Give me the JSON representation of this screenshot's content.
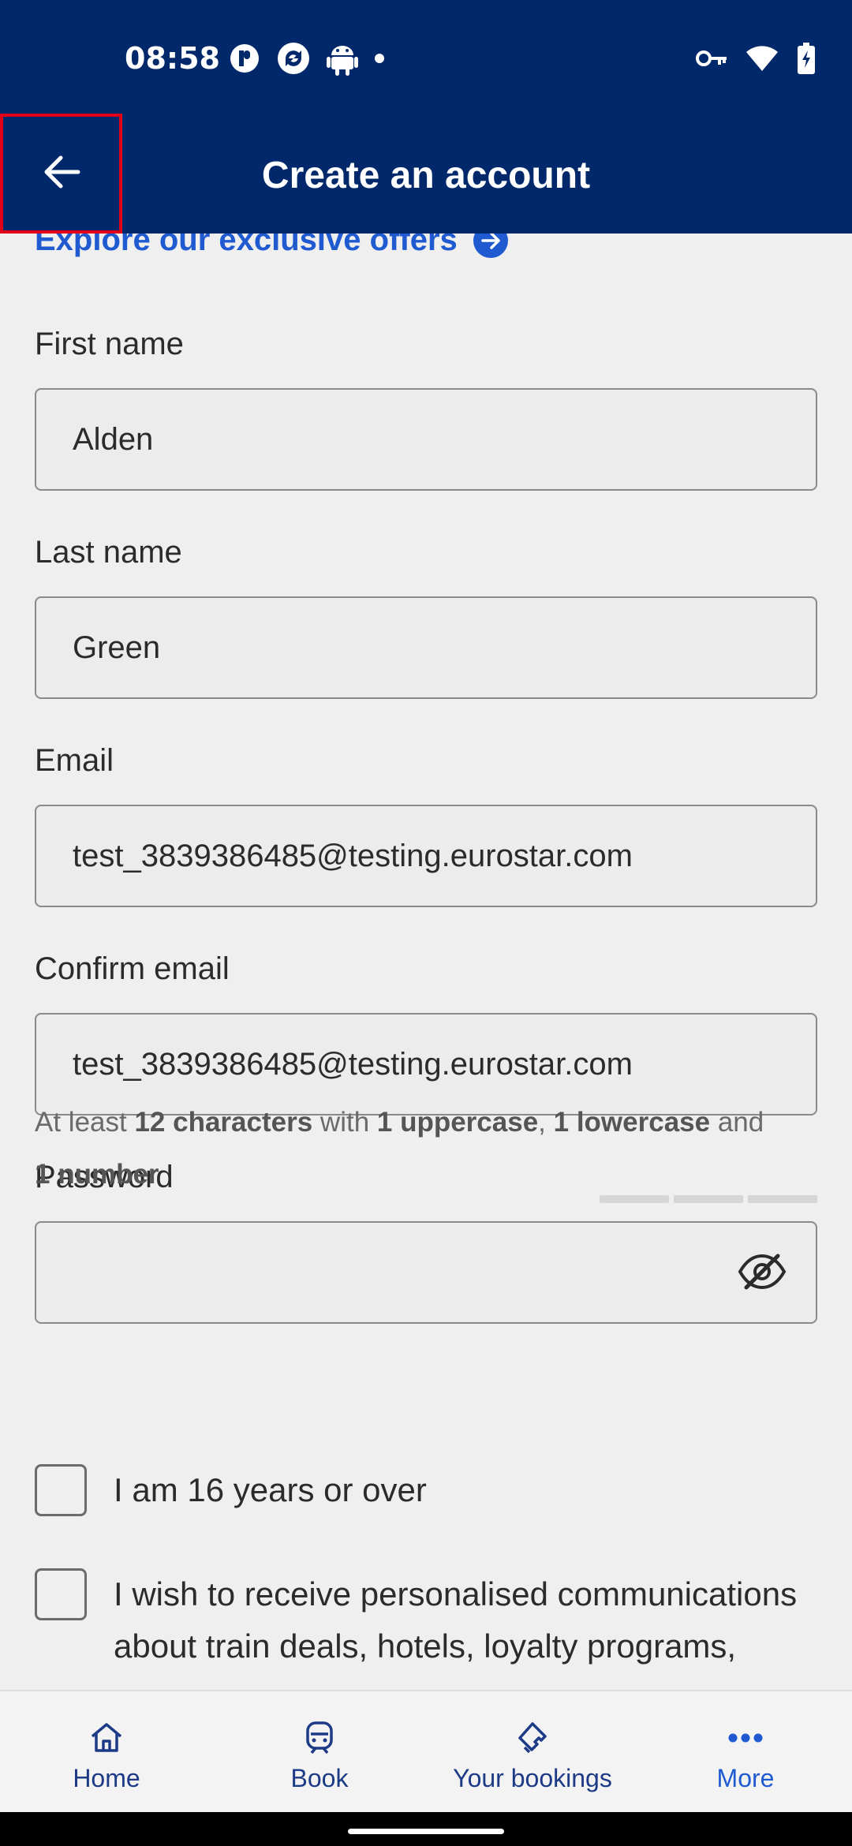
{
  "status_bar": {
    "time": "08:58",
    "left_icons": [
      "p-app-icon",
      "refresh-app-icon",
      "android-icon",
      "dot-icon"
    ],
    "right_icons": [
      "key-icon",
      "wifi-icon",
      "battery-charging-icon"
    ]
  },
  "app_bar": {
    "title": "Create an account",
    "back_icon": "arrow-left-icon"
  },
  "offers": {
    "label": "Explore our exclusive offers"
  },
  "form": {
    "first_name": {
      "label": "First name",
      "value": "Alden"
    },
    "last_name": {
      "label": "Last name",
      "value": "Green"
    },
    "email": {
      "label": "Email",
      "value": "test_3839386485@testing.eurostar.com"
    },
    "confirm_email": {
      "label": "Confirm email",
      "value": "test_3839386485@testing.eurostar.com"
    },
    "password": {
      "label": "Password",
      "value": "",
      "hint_prefix": "At least ",
      "hint_b1": "12 characters",
      "hint_mid1": " with ",
      "hint_b2": "1 uppercase",
      "hint_mid2": ", ",
      "hint_b3": "1 lowercase",
      "hint_mid3": " and ",
      "hint_b4": "1 number"
    },
    "age_checkbox": {
      "label": "I am 16 years or over",
      "checked": false
    },
    "comms_checkbox": {
      "label": "I wish to receive personalised communications about train deals, hotels, loyalty programs,",
      "checked": false
    }
  },
  "bottom_nav": {
    "items": [
      {
        "label": "Home",
        "icon": "home-icon"
      },
      {
        "label": "Book",
        "icon": "train-icon"
      },
      {
        "label": "Your bookings",
        "icon": "ticket-icon"
      },
      {
        "label": "More",
        "icon": "more-dots-icon"
      }
    ]
  },
  "colors": {
    "header": "#00286a",
    "link": "#1f5ad1",
    "nav_text": "#1d3a86",
    "highlight": "#e0001a"
  }
}
